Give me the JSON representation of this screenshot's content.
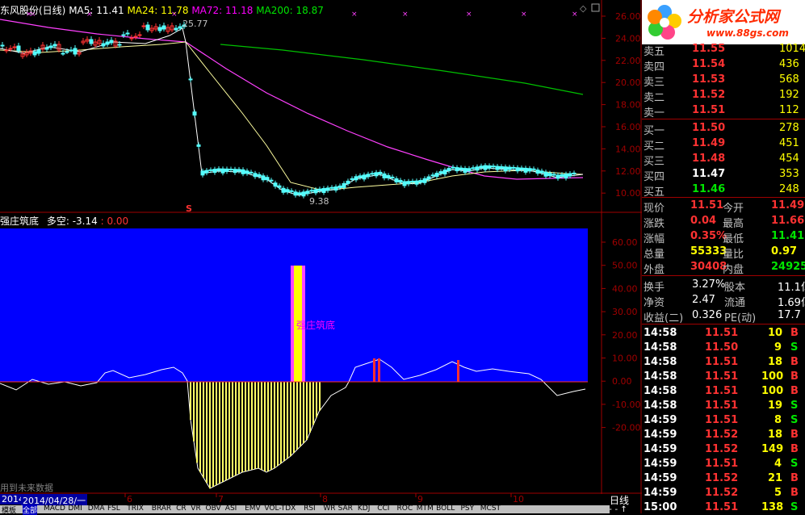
{
  "header": {
    "stock": "东风股份(日线)",
    "ma5": "MA5: 11.41",
    "ma24": "MA24: 11.78",
    "ma72": "MA72: 11.18",
    "ma200": "MA200: 18.87",
    "high_label": "25.77",
    "low_label": "9.38",
    "s_mark": "S"
  },
  "indicator": {
    "name": "强庄筑底",
    "duokong": "多空: -3.14",
    "extra": ": 0.00",
    "bar_label": "强庄筑底"
  },
  "price_axis": [
    "26.00",
    "24.00",
    "22.00",
    "20.00",
    "18.00",
    "16.00",
    "14.00",
    "12.00",
    "10.00"
  ],
  "ind_axis": [
    "60.00",
    "50.00",
    "40.00",
    "30.00",
    "20.00",
    "10.00",
    "0.00",
    "-10.00",
    "-20.00"
  ],
  "bottom": {
    "notice": "用到未来数据",
    "date": "2014/04/28/一",
    "months": [
      "6",
      "7",
      "8",
      "9",
      "10"
    ],
    "year_left": "2014",
    "period": "日线"
  },
  "tabs": [
    "模板",
    "全部",
    "MACD",
    "DMI",
    "DMA",
    "FSL",
    "TRIX",
    "BRAR",
    "CR",
    "VR",
    "OBV",
    "ASI",
    "EMV",
    "VOL-TDX",
    "RSI",
    "WR",
    "SAR",
    "KDJ",
    "CCI",
    "ROC",
    "MTM",
    "BOLL",
    "PSY",
    "MCST"
  ],
  "logo": {
    "title": "分析家公式网",
    "url": "www.88gs.com"
  },
  "quotes": {
    "sell": [
      {
        "label": "卖五",
        "price": "11.55",
        "vol": "1014"
      },
      {
        "label": "卖四",
        "price": "11.54",
        "vol": "436"
      },
      {
        "label": "卖三",
        "price": "11.53",
        "vol": "568"
      },
      {
        "label": "卖二",
        "price": "11.52",
        "vol": "192"
      },
      {
        "label": "卖一",
        "price": "11.51",
        "vol": "112"
      }
    ],
    "buy": [
      {
        "label": "买一",
        "price": "11.50",
        "vol": "278"
      },
      {
        "label": "买二",
        "price": "11.49",
        "vol": "451"
      },
      {
        "label": "买三",
        "price": "11.48",
        "vol": "454"
      },
      {
        "label": "买四",
        "price": "11.47",
        "vol": "353"
      },
      {
        "label": "买五",
        "price": "11.46",
        "vol": "248"
      }
    ]
  },
  "stats": [
    {
      "l1": "现价",
      "v1": "11.51",
      "l2": "今开",
      "v2": "11.49"
    },
    {
      "l1": "涨跌",
      "v1": "0.04",
      "l2": "最高",
      "v2": "11.66"
    },
    {
      "l1": "涨幅",
      "v1": "0.35%",
      "l2": "最低",
      "v2": "11.41"
    },
    {
      "l1": "总量",
      "v1": "55333",
      "l2": "量比",
      "v2": "0.97"
    },
    {
      "l1": "外盘",
      "v1": "30408",
      "l2": "内盘",
      "v2": "24925"
    }
  ],
  "stats2": [
    {
      "l1": "换手",
      "v1": "3.27%",
      "l2": "股本",
      "v2": "11.1亿"
    },
    {
      "l1": "净资",
      "v1": "2.47",
      "l2": "流通",
      "v2": "1.69亿"
    },
    {
      "l1": "收益(二)",
      "v1": "0.326",
      "l2": "PE(动)",
      "v2": "17.7"
    }
  ],
  "trades": [
    {
      "t": "14:58",
      "p": "11.51",
      "v": "10",
      "d": "B"
    },
    {
      "t": "14:58",
      "p": "11.50",
      "v": "9",
      "d": "S"
    },
    {
      "t": "14:58",
      "p": "11.51",
      "v": "18",
      "d": "B"
    },
    {
      "t": "14:58",
      "p": "11.51",
      "v": "100",
      "d": "B"
    },
    {
      "t": "14:58",
      "p": "11.51",
      "v": "100",
      "d": "B"
    },
    {
      "t": "14:58",
      "p": "11.51",
      "v": "19",
      "d": "S"
    },
    {
      "t": "14:59",
      "p": "11.51",
      "v": "8",
      "d": "S"
    },
    {
      "t": "14:59",
      "p": "11.52",
      "v": "18",
      "d": "B"
    },
    {
      "t": "14:59",
      "p": "11.52",
      "v": "149",
      "d": "B"
    },
    {
      "t": "14:59",
      "p": "11.51",
      "v": "4",
      "d": "S"
    },
    {
      "t": "14:59",
      "p": "11.52",
      "v": "21",
      "d": "B"
    },
    {
      "t": "14:59",
      "p": "11.52",
      "v": "5",
      "d": "B"
    },
    {
      "t": "15:00",
      "p": "11.51",
      "v": "138",
      "d": "S"
    }
  ],
  "colors": {
    "red": "#ff3232",
    "green": "#00e600",
    "white": "#ffffff",
    "yellow": "#ffff00",
    "blue": "#0000ff",
    "magenta": "#ff00ff",
    "grid": "#a00000"
  }
}
